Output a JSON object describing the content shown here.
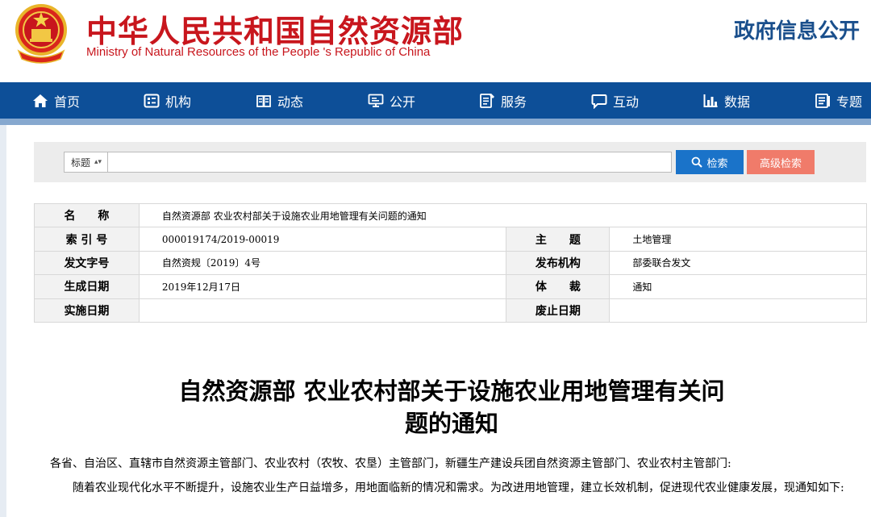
{
  "header": {
    "title_cn": "中华人民共和国自然资源部",
    "title_en": "Ministry of Natural Resources of the People 's Republic of China",
    "gov_info": "政府信息公开",
    "emblem_icon": "national-emblem-icon"
  },
  "nav": {
    "items": [
      {
        "label": "首页",
        "icon": "home-icon"
      },
      {
        "label": "机构",
        "icon": "organization-icon"
      },
      {
        "label": "动态",
        "icon": "news-icon"
      },
      {
        "label": "公开",
        "icon": "monitor-icon"
      },
      {
        "label": "服务",
        "icon": "service-icon"
      },
      {
        "label": "互动",
        "icon": "chat-icon"
      },
      {
        "label": "数据",
        "icon": "bar-chart-icon"
      },
      {
        "label": "专题",
        "icon": "topic-icon"
      }
    ]
  },
  "search": {
    "field_select": "标题",
    "input_value": "",
    "search_button": "检索",
    "advanced_button": "高级检索"
  },
  "meta": {
    "name_label": "名　　称",
    "name_value": "自然资源部 农业农村部关于设施农业用地管理有关问题的通知",
    "index_label": "索 引 号",
    "index_value": "000019174/2019-00019",
    "subject_label": "主　　题",
    "subject_value": "土地管理",
    "doc_no_label": "发文字号",
    "doc_no_value": "自然资规〔2019〕4号",
    "issuer_label": "发布机构",
    "issuer_value": "部委联合发文",
    "date_label": "生成日期",
    "date_value": "2019年12月17日",
    "genre_label": "体　　裁",
    "genre_value": "通知",
    "effective_label": "实施日期",
    "effective_value": "",
    "expiry_label": "废止日期",
    "expiry_value": ""
  },
  "article": {
    "title_line1": "自然资源部 农业农村部关于设施农业用地管理有关问",
    "title_line2": "题的通知",
    "para1": "各省、自治区、直辖市自然资源主管部门、农业农村（农牧、农垦）主管部门，新疆生产建设兵团自然资源主管部门、农业农村主管部门:",
    "para2": "随着农业现代化水平不断提升，设施农业生产日益增多，用地面临新的情况和需求。为改进用地管理，建立长效机制，促进现代农业健康发展，现通知如下:"
  },
  "colors": {
    "brand_red": "#c8161d",
    "nav_blue": "#0d4f98",
    "search_blue": "#1a73c9",
    "advanced_red": "#f07b6a"
  }
}
